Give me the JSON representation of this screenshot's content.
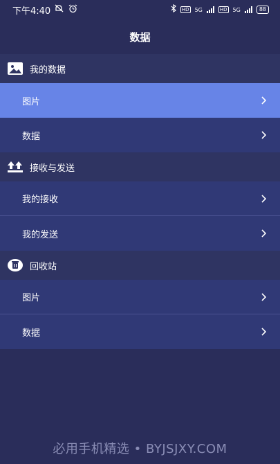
{
  "status_bar": {
    "time": "下午4:40",
    "hd1": "HD",
    "net1": "5G",
    "hd2": "HD",
    "net2": "5G",
    "battery": "88"
  },
  "header": {
    "title": "数据"
  },
  "sections": [
    {
      "title": "我的数据",
      "icon": "image-icon",
      "items": [
        {
          "label": "图片",
          "active": true
        },
        {
          "label": "数据",
          "active": false
        }
      ]
    },
    {
      "title": "接收与发送",
      "icon": "transfer-arrows-icon",
      "items": [
        {
          "label": "我的接收",
          "active": false
        },
        {
          "label": "我的发送",
          "active": false
        }
      ]
    },
    {
      "title": "回收站",
      "icon": "trash-icon",
      "items": [
        {
          "label": "图片",
          "active": false
        },
        {
          "label": "数据",
          "active": false
        }
      ]
    }
  ],
  "watermark": "必用手机精选 • BYJSJXY.COM",
  "colors": {
    "background": "#2a2d5a",
    "section_header": "#2f3462",
    "row": "#303976",
    "row_active": "#6784e7"
  }
}
